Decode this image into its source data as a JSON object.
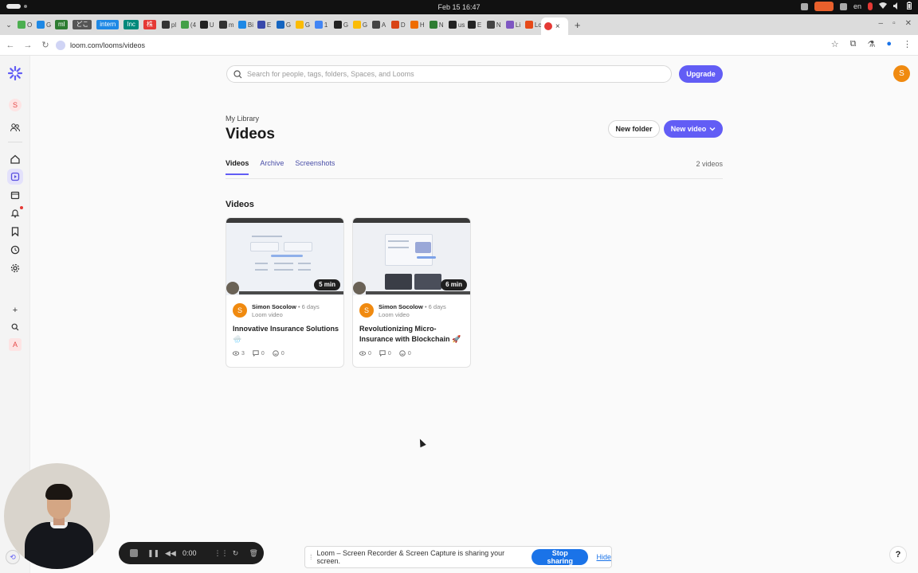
{
  "os": {
    "clock": "Feb 15  16:47",
    "lang": "en"
  },
  "browser": {
    "tabs": [
      {
        "label": "O",
        "color": "#4caf50"
      },
      {
        "label": "G",
        "color": "#1e88e5"
      },
      {
        "label": "ml",
        "color": "#2e7d32",
        "badge": true
      },
      {
        "label": "どこ",
        "color": "#555",
        "badge": true
      },
      {
        "label": "intern",
        "color": "#1e88e5",
        "badge": true
      },
      {
        "label": "Inc",
        "color": "#00897b",
        "badge": true
      },
      {
        "label": "株",
        "color": "#e53935",
        "badge": true
      },
      {
        "label": "pl",
        "color": "#333"
      },
      {
        "label": "(4",
        "color": "#43a047"
      },
      {
        "label": "U",
        "color": "#222"
      },
      {
        "label": "m",
        "color": "#333"
      },
      {
        "label": "Bi",
        "color": "#1e88e5"
      },
      {
        "label": "E",
        "color": "#3949ab"
      },
      {
        "label": "G",
        "color": "#1565c0"
      },
      {
        "label": "G",
        "color": "#fbbc05"
      },
      {
        "label": "1",
        "color": "#4285f4"
      },
      {
        "label": "G",
        "color": "#222"
      },
      {
        "label": "G",
        "color": "#fbbc05"
      },
      {
        "label": "A",
        "color": "#444"
      },
      {
        "label": "D",
        "color": "#d84315"
      },
      {
        "label": "H",
        "color": "#ef6c00"
      },
      {
        "label": "N",
        "color": "#2e7d32"
      },
      {
        "label": "us",
        "color": "#222"
      },
      {
        "label": "E",
        "color": "#222"
      },
      {
        "label": "N",
        "color": "#444"
      },
      {
        "label": "Li",
        "color": "#7e57c2"
      },
      {
        "label": "Lc",
        "color": "#e64a19"
      }
    ],
    "active_tab_label": "×",
    "url": "loom.com/looms/videos"
  },
  "search": {
    "placeholder": "Search for people, tags, folders, Spaces, and Looms"
  },
  "header": {
    "upgrade_label": "Upgrade",
    "avatar_initial": "S"
  },
  "page": {
    "breadcrumb": "My Library",
    "title": "Videos",
    "new_folder_label": "New folder",
    "new_video_label": "New video",
    "tabs": [
      {
        "label": "Videos",
        "active": true
      },
      {
        "label": "Archive",
        "active": false
      },
      {
        "label": "Screenshots",
        "active": false
      }
    ],
    "video_count": "2 videos",
    "section_title": "Videos"
  },
  "rail": {
    "avatar_initial": "S",
    "bottom_avatar": "A"
  },
  "videos": [
    {
      "duration": "5 min",
      "owner": "Simon Socolow",
      "ago": "6 days",
      "kind": "Loom video",
      "title": "Innovative Insurance Solutions 🌧️",
      "views": "3",
      "comments": "0",
      "reactions": "0"
    },
    {
      "duration": "6 min",
      "owner": "Simon Socolow",
      "ago": "6 days",
      "kind": "Loom video",
      "title": "Revolutionizing Micro-Insurance with Blockchain 🚀",
      "views": "0",
      "comments": "0",
      "reactions": "0"
    }
  ],
  "recorder": {
    "time": "0:00"
  },
  "share": {
    "message": "Loom – Screen Recorder & Screen Capture is sharing your screen.",
    "stop_label": "Stop sharing",
    "hide_label": "Hide"
  },
  "help_label": "?"
}
